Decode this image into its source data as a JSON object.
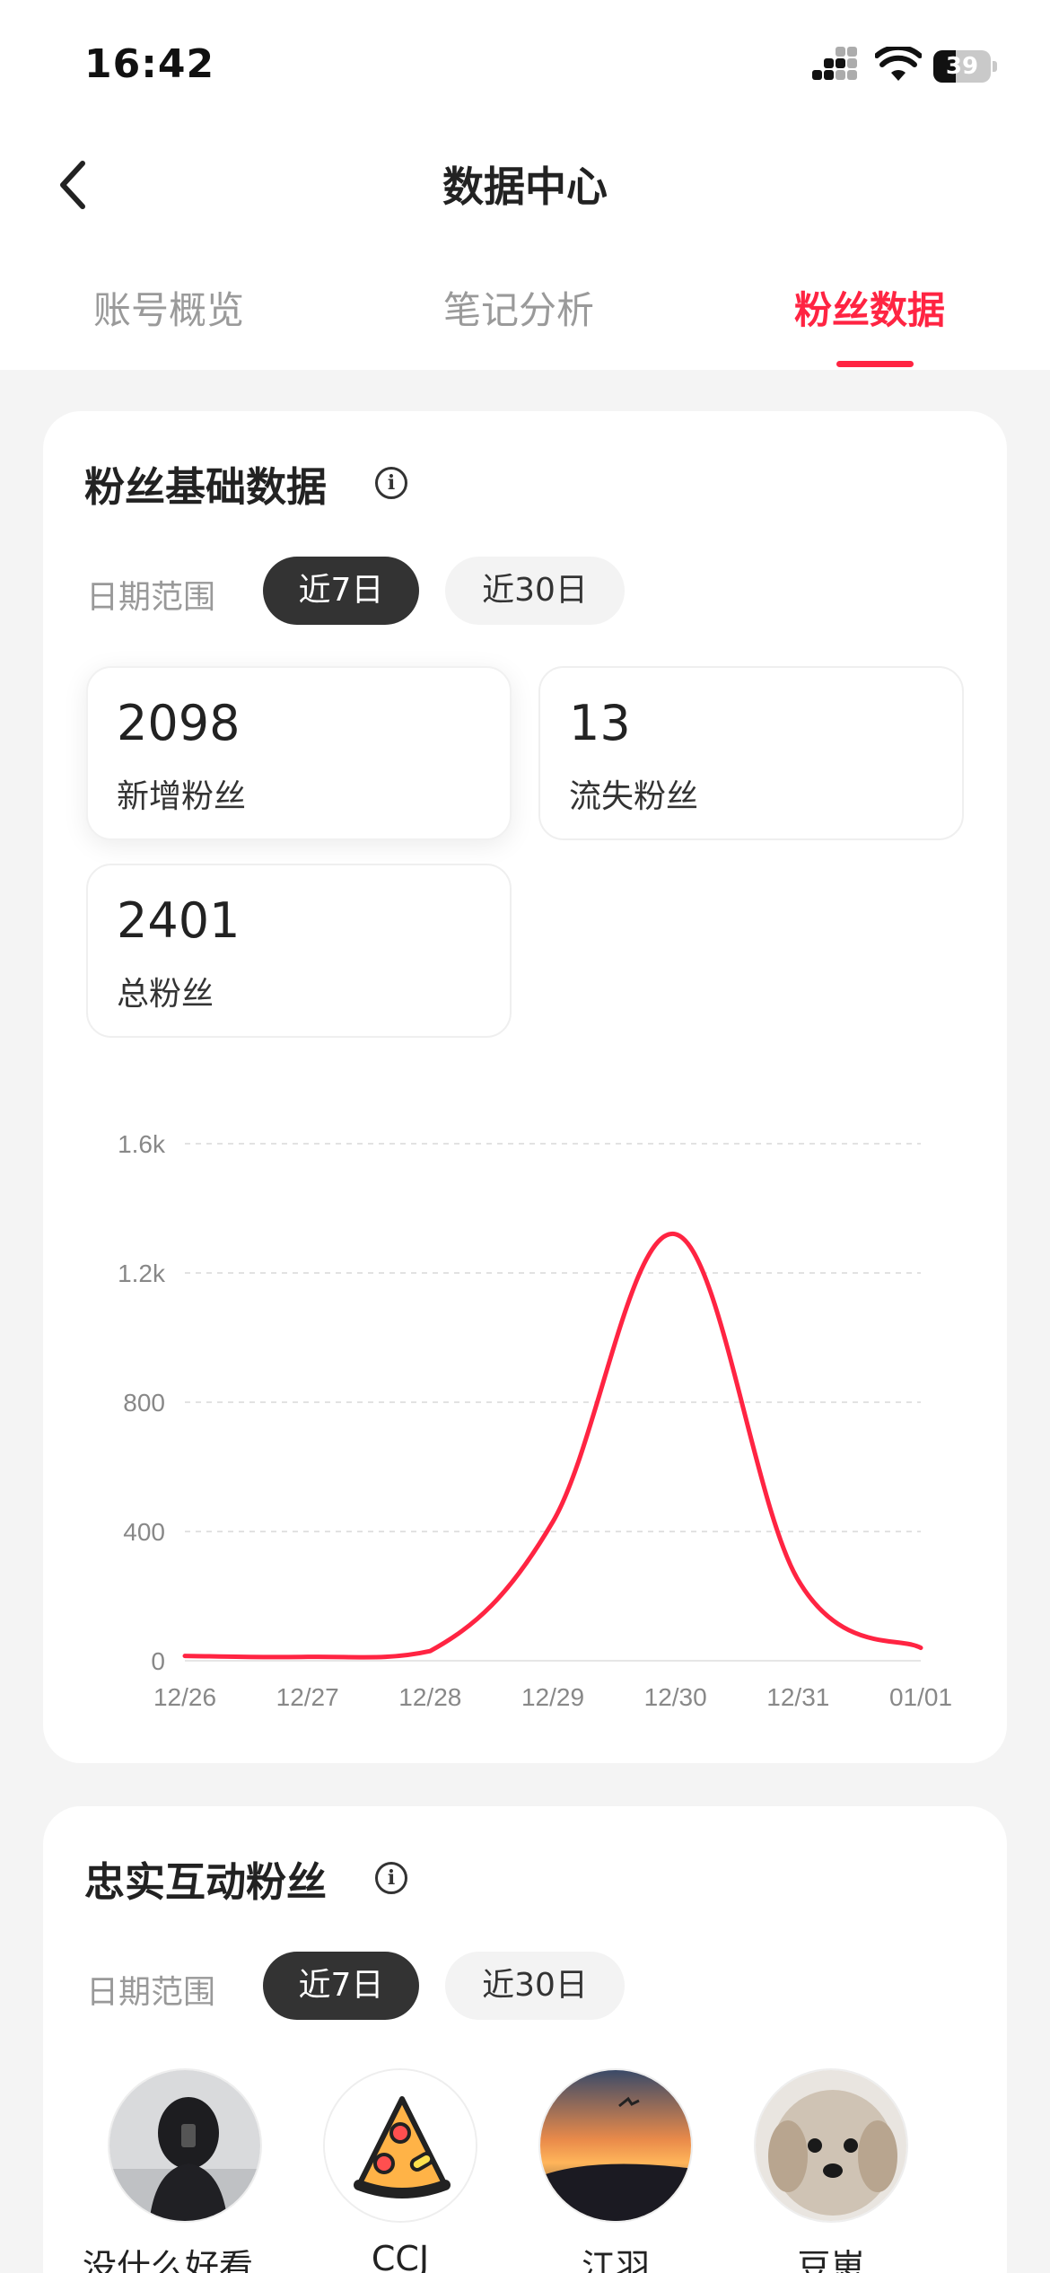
{
  "status_bar": {
    "time": "16:42",
    "battery": "39",
    "battery_level": 0.39
  },
  "nav": {
    "title": "数据中心"
  },
  "tabs": [
    {
      "label": "账号概览",
      "active": false
    },
    {
      "label": "笔记分析",
      "active": false
    },
    {
      "label": "粉丝数据",
      "active": true
    }
  ],
  "colors": {
    "accent": "#ff2442",
    "pill_active": "#333333"
  },
  "basic": {
    "title": "粉丝基础数据",
    "range_label": "日期范围",
    "range_options": [
      "近7日",
      "近30日"
    ],
    "range_selected": "近7日",
    "stats": [
      {
        "value": "2098",
        "label": "新增粉丝"
      },
      {
        "value": "13",
        "label": "流失粉丝"
      },
      {
        "value": "2401",
        "label": "总粉丝"
      }
    ]
  },
  "chart_data": {
    "type": "line",
    "categories": [
      "12/26",
      "12/27",
      "12/28",
      "12/29",
      "12/30",
      "12/31",
      "01/01"
    ],
    "series": [
      {
        "values": [
          15,
          12,
          30,
          430,
          1320,
          250,
          40
        ],
        "color": "#ff2442"
      }
    ],
    "y_ticks": [
      "0",
      "400",
      "800",
      "1.2k",
      "1.6k"
    ],
    "ylim": [
      0,
      1600
    ],
    "grid": true
  },
  "loyal": {
    "title": "忠实互动粉丝",
    "range_label": "日期范围",
    "range_options": [
      "近7日",
      "近30日"
    ],
    "range_selected": "近7日",
    "fans": [
      {
        "name": "没什么好看…",
        "avatar": "girl-photo-avatar"
      },
      {
        "name": "CCJ",
        "avatar": "pizza-icon"
      },
      {
        "name": "江羽",
        "avatar": "sunset-photo-avatar"
      },
      {
        "name": "豆崽",
        "avatar": "puppy-photo-avatar"
      }
    ]
  }
}
